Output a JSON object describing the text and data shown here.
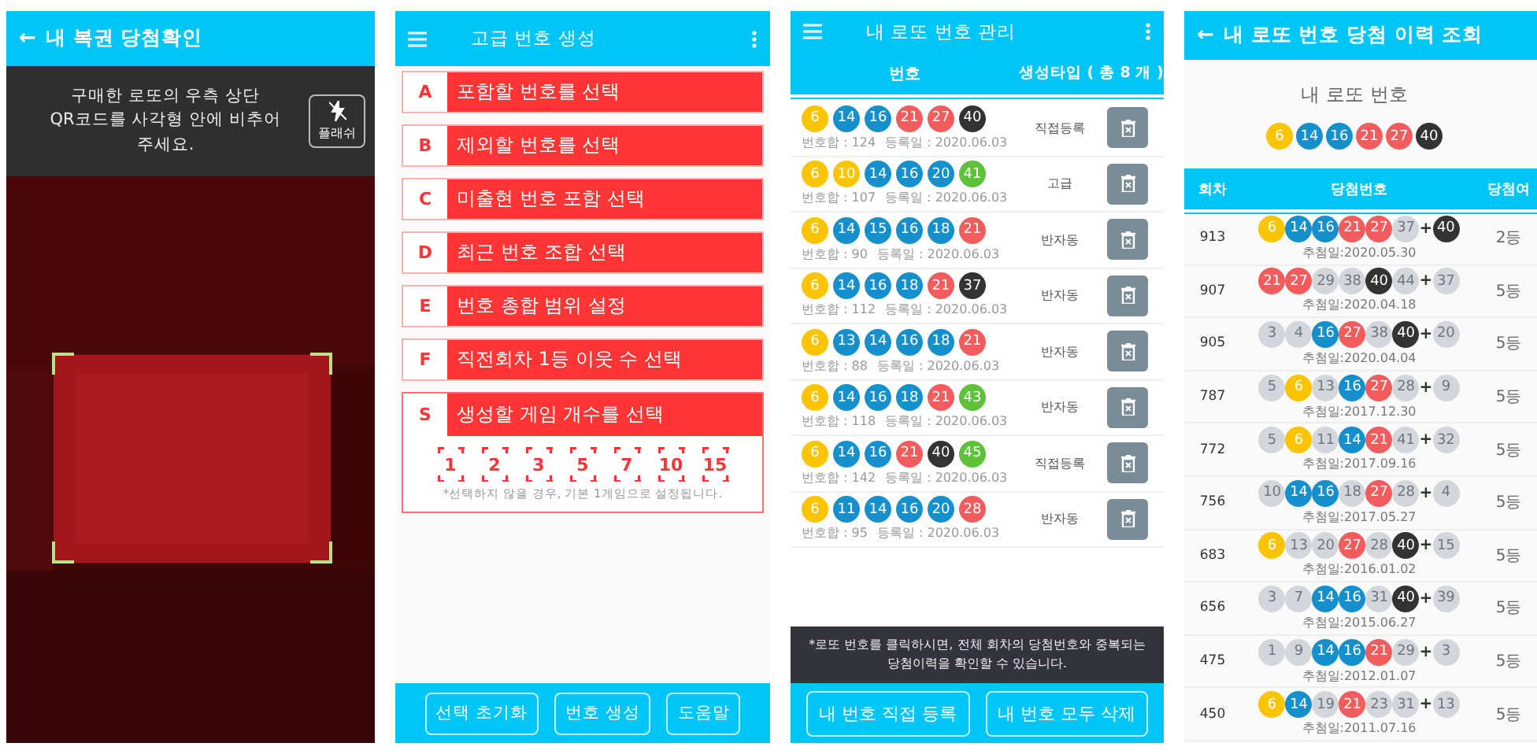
{
  "qr_screen": {
    "back": "←",
    "title": "내 복권 당첨확인",
    "instruction": "구매한 로또의 우측 상단\nQR코드를 사각형 안에 비추어\n주세요.",
    "flash_button": "플래쉬"
  },
  "advanced_screen": {
    "title": "고급 번호 생성",
    "options": [
      {
        "letter": "A",
        "label": "포함할 번호를 선택"
      },
      {
        "letter": "B",
        "label": "제외할 번호를 선택"
      },
      {
        "letter": "C",
        "label": "미출현 번호 포함 선택"
      },
      {
        "letter": "D",
        "label": "최근 번호 조합 선택"
      },
      {
        "letter": "E",
        "label": "번호 총합 범위 설정"
      },
      {
        "letter": "F",
        "label": "직전회차 1등 이웃 수 선택"
      }
    ],
    "game_count": {
      "letter": "S",
      "label": "생성할 게임 개수를 선택",
      "counts": [
        {
          "label": "1",
          "selected": false
        },
        {
          "label": "2",
          "selected": false
        },
        {
          "label": "3",
          "selected": false
        },
        {
          "label": "5",
          "selected": false
        },
        {
          "label": "7",
          "selected": false
        },
        {
          "label": "10",
          "selected": false
        },
        {
          "label": "15",
          "selected": false
        }
      ],
      "note": "*선택하지 않을 경우, 기본 1게임으로 설정됩니다."
    },
    "buttons": [
      "선택 초기화",
      "번호 생성",
      "도움말"
    ]
  },
  "my_numbers_screen": {
    "title": "내 로또 번호 관리",
    "columns": [
      "번호",
      "생성타입 ( 총 8 개 )"
    ],
    "rows": [
      {
        "balls": [
          "6",
          "14",
          "16",
          "21",
          "27",
          "40"
        ],
        "sum": "번호합 : 124",
        "date": "등록일 : 2020.06.03",
        "type": "직접등록"
      },
      {
        "balls": [
          "6",
          "10",
          "14",
          "16",
          "20",
          "41"
        ],
        "sum": "번호합 : 107",
        "date": "등록일 : 2020.06.03",
        "type": "고급"
      },
      {
        "balls": [
          "6",
          "14",
          "15",
          "16",
          "18",
          "21"
        ],
        "sum": "번호합 : 90",
        "date": "등록일 : 2020.06.03",
        "type": "반자동"
      },
      {
        "balls": [
          "6",
          "14",
          "16",
          "18",
          "21",
          "37"
        ],
        "sum": "번호합 : 112",
        "date": "등록일 : 2020.06.03",
        "type": "반자동"
      },
      {
        "balls": [
          "6",
          "13",
          "14",
          "16",
          "18",
          "21"
        ],
        "sum": "번호합 : 88",
        "date": "등록일 : 2020.06.03",
        "type": "반자동"
      },
      {
        "balls": [
          "6",
          "14",
          "16",
          "18",
          "21",
          "43"
        ],
        "sum": "번호합 : 118",
        "date": "등록일 : 2020.06.03",
        "type": "반자동"
      },
      {
        "balls": [
          "6",
          "14",
          "16",
          "21",
          "40",
          "45"
        ],
        "sum": "번호합 : 142",
        "date": "등록일 : 2020.06.03",
        "type": "직접등록"
      },
      {
        "balls": [
          "6",
          "11",
          "14",
          "16",
          "20",
          "28"
        ],
        "sum": "번호합 : 95",
        "date": "등록일 : 2020.06.03",
        "type": "반자동"
      }
    ],
    "note": "*로또 번호를 클릭하시면, 전체 회차의 당첨번호와 중복되는\n당첨이력을 확인할 수 있습니다.",
    "buttons": [
      "내 번호 직접 등록",
      "내 번호 모두 삭제"
    ]
  },
  "history_screen": {
    "back": "←",
    "title": "내 로또 번호 당첨 이력 조회",
    "my_label": "내 로또 번호",
    "my_balls": [
      "6",
      "14",
      "16",
      "21",
      "27",
      "40"
    ],
    "columns": [
      "회차",
      "당첨번호",
      "당첨여"
    ],
    "rows": [
      {
        "round": "913",
        "balls": [
          {
            "n": "6",
            "matched": true
          },
          {
            "n": "14",
            "matched": true
          },
          {
            "n": "16",
            "matched": true
          },
          {
            "n": "21",
            "matched": true
          },
          {
            "n": "27",
            "matched": true
          },
          {
            "n": "37",
            "matched": false
          }
        ],
        "plus": "+",
        "bonus": {
          "n": "40",
          "matched": true
        },
        "date": "추첨일:2020.05.30",
        "rank": "2등"
      },
      {
        "round": "907",
        "balls": [
          {
            "n": "21",
            "matched": true
          },
          {
            "n": "27",
            "matched": true
          },
          {
            "n": "29",
            "matched": false
          },
          {
            "n": "38",
            "matched": false
          },
          {
            "n": "40",
            "matched": true
          },
          {
            "n": "44",
            "matched": false
          }
        ],
        "plus": "+",
        "bonus": {
          "n": "37",
          "matched": false
        },
        "date": "추첨일:2020.04.18",
        "rank": "5등"
      },
      {
        "round": "905",
        "balls": [
          {
            "n": "3",
            "matched": false
          },
          {
            "n": "4",
            "matched": false
          },
          {
            "n": "16",
            "matched": true
          },
          {
            "n": "27",
            "matched": true
          },
          {
            "n": "38",
            "matched": false
          },
          {
            "n": "40",
            "matched": true
          }
        ],
        "plus": "+",
        "bonus": {
          "n": "20",
          "matched": false
        },
        "date": "추첨일:2020.04.04",
        "rank": "5등"
      },
      {
        "round": "787",
        "balls": [
          {
            "n": "5",
            "matched": false
          },
          {
            "n": "6",
            "matched": true
          },
          {
            "n": "13",
            "matched": false
          },
          {
            "n": "16",
            "matched": true
          },
          {
            "n": "27",
            "matched": true
          },
          {
            "n": "28",
            "matched": false
          }
        ],
        "plus": "+",
        "bonus": {
          "n": "9",
          "matched": false
        },
        "date": "추첨일:2017.12.30",
        "rank": "5등"
      },
      {
        "round": "772",
        "balls": [
          {
            "n": "5",
            "matched": false
          },
          {
            "n": "6",
            "matched": true
          },
          {
            "n": "11",
            "matched": false
          },
          {
            "n": "14",
            "matched": true
          },
          {
            "n": "21",
            "matched": true
          },
          {
            "n": "41",
            "matched": false
          }
        ],
        "plus": "+",
        "bonus": {
          "n": "32",
          "matched": false
        },
        "date": "추첨일:2017.09.16",
        "rank": "5등"
      },
      {
        "round": "756",
        "balls": [
          {
            "n": "10",
            "matched": false
          },
          {
            "n": "14",
            "matched": true
          },
          {
            "n": "16",
            "matched": true
          },
          {
            "n": "18",
            "matched": false
          },
          {
            "n": "27",
            "matched": true
          },
          {
            "n": "28",
            "matched": false
          }
        ],
        "plus": "+",
        "bonus": {
          "n": "4",
          "matched": false
        },
        "date": "추첨일:2017.05.27",
        "rank": "5등"
      },
      {
        "round": "683",
        "balls": [
          {
            "n": "6",
            "matched": true
          },
          {
            "n": "13",
            "matched": false
          },
          {
            "n": "20",
            "matched": false
          },
          {
            "n": "27",
            "matched": true
          },
          {
            "n": "28",
            "matched": false
          },
          {
            "n": "40",
            "matched": true
          }
        ],
        "plus": "+",
        "bonus": {
          "n": "15",
          "matched": false
        },
        "date": "추첨일:2016.01.02",
        "rank": "5등"
      },
      {
        "round": "656",
        "balls": [
          {
            "n": "3",
            "matched": false
          },
          {
            "n": "7",
            "matched": false
          },
          {
            "n": "14",
            "matched": true
          },
          {
            "n": "16",
            "matched": true
          },
          {
            "n": "31",
            "matched": false
          },
          {
            "n": "40",
            "matched": true
          }
        ],
        "plus": "+",
        "bonus": {
          "n": "39",
          "matched": false
        },
        "date": "추첨일:2015.06.27",
        "rank": "5등"
      },
      {
        "round": "475",
        "balls": [
          {
            "n": "1",
            "matched": false
          },
          {
            "n": "9",
            "matched": false
          },
          {
            "n": "14",
            "matched": true
          },
          {
            "n": "16",
            "matched": true
          },
          {
            "n": "21",
            "matched": true
          },
          {
            "n": "29",
            "matched": false
          }
        ],
        "plus": "+",
        "bonus": {
          "n": "3",
          "matched": false
        },
        "date": "추첨일:2012.01.07",
        "rank": "5등"
      },
      {
        "round": "450",
        "balls": [
          {
            "n": "6",
            "matched": true
          },
          {
            "n": "14",
            "matched": true
          },
          {
            "n": "19",
            "matched": false
          },
          {
            "n": "21",
            "matched": true
          },
          {
            "n": "23",
            "matched": false
          },
          {
            "n": "31",
            "matched": false
          }
        ],
        "plus": "+",
        "bonus": {
          "n": "13",
          "matched": false
        },
        "date": "추첨일:2011.07.16",
        "rank": "5등"
      }
    ]
  }
}
